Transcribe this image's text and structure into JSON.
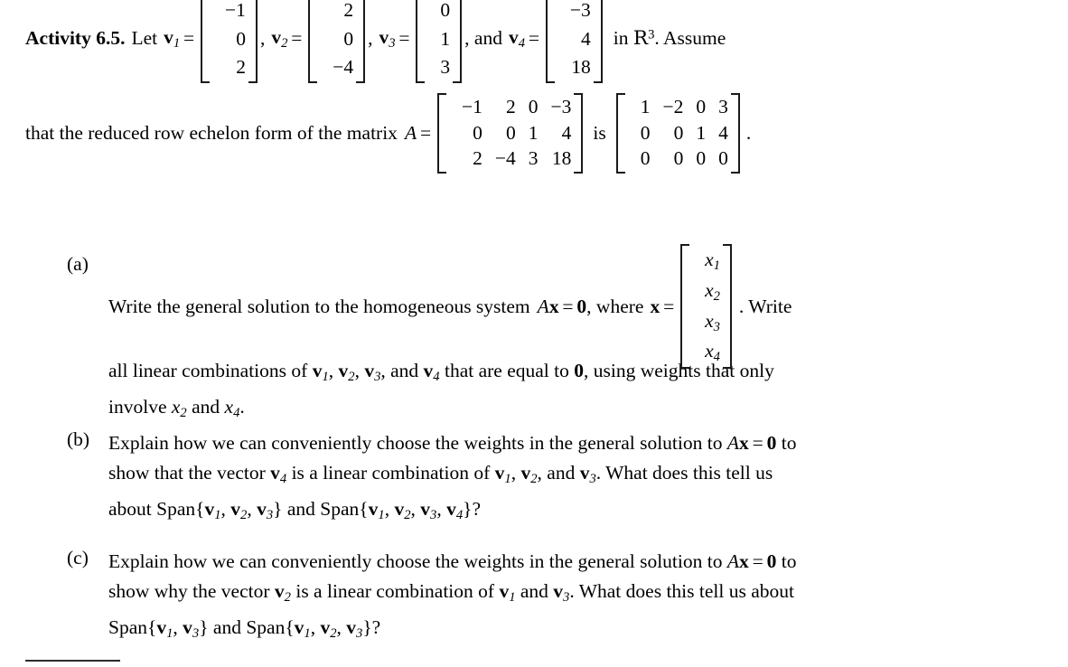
{
  "document": {
    "activity_label": "Activity 6.5.",
    "intro_lead": "Let",
    "vectors": [
      {
        "name": "v",
        "index": "1",
        "entries": [
          "−1",
          "0",
          "2"
        ]
      },
      {
        "name": "v",
        "index": "2",
        "entries": [
          "2",
          "0",
          "−4"
        ]
      },
      {
        "name": "v",
        "index": "3",
        "entries": [
          "0",
          "1",
          "3"
        ]
      },
      {
        "name": "v",
        "index": "4",
        "entries": [
          "−3",
          "4",
          "18"
        ]
      }
    ],
    "separators": {
      "comma": ",",
      "equals": "=",
      "and_before_last": ", and",
      "period": ".",
      "question": "?"
    },
    "space_text": "in",
    "space_symbol": "R",
    "space_exponent": "3",
    "space_trailing": ". Assume",
    "assume_lead": "that the reduced row echelon form of the matrix",
    "matrix_A_name": "A",
    "matrix_A": [
      [
        "−1",
        "2",
        "0",
        "−3"
      ],
      [
        "0",
        "0",
        "1",
        "4"
      ],
      [
        "2",
        "−4",
        "3",
        "18"
      ]
    ],
    "is_word": "is",
    "matrix_rref": [
      [
        "1",
        "−2",
        "0",
        "3"
      ],
      [
        "0",
        "0",
        "1",
        "4"
      ],
      [
        "0",
        "0",
        "0",
        "0"
      ]
    ],
    "matrix_rref_trailing": "."
  },
  "items": [
    {
      "label": "(a)",
      "line1_pre": "Write the general solution to the homogeneous system",
      "equation_matrix": "A",
      "equation_x": "x",
      "equation_eq": "=",
      "equation_zero": "0",
      "line1_mid": ", where",
      "x_vector_name": "x",
      "x_vector_entries": [
        "x",
        "x",
        "x",
        "x"
      ],
      "x_vector_subs": [
        "1",
        "2",
        "3",
        "4"
      ],
      "line1_post": ". Write",
      "line2": "all linear combinations of v₁, v₂, v₃, and v₄ that are equal to 0, using weights that only",
      "line3": "involve x₂ and x₄."
    },
    {
      "label": "(b)",
      "line1": "Explain how we can conveniently choose the weights in the general solution to Ax = 0 to",
      "line2": "show that the vector v₄ is a linear combination of v₁, v₂, and v₃. What does this tell us",
      "line3": "about Span{v₁, v₂, v₃} and Span{v₁, v₂, v₃, v₄}?"
    },
    {
      "label": "(c)",
      "line1": "Explain how we can conveniently choose the weights in the general solution to Ax = 0 to",
      "line2": "show why the vector v₂ is a linear combination of v₁ and v₃. What does this tell us about",
      "line3": "Span{v₁, v₃} and Span{v₁, v₂, v₃}?"
    }
  ],
  "words": {
    "all_linear_combinations_of": "all linear combinations of",
    "that_are_equal_to": "that are equal to",
    "zero_bold": "0",
    "using_weights_that_only": ", using weights that only",
    "involve": "involve",
    "and_word": "and",
    "explain_lead": "Explain how we can conveniently choose the weights in the general solution to",
    "to_word": "to",
    "show_that": "show that the vector",
    "show_why": "show why the vector",
    "is_a_lin_comb_of": "is a linear combination of",
    "what_does_this_tell_us": ". What does this tell us",
    "what_does_this_tell_us_about": ". What does this tell us about",
    "about_word": "about",
    "span_word": "Span",
    "brace_open": "{",
    "brace_close": "}",
    "comma_sp": ", ",
    "period": "."
  },
  "footnote_rule": {
    "visible": true,
    "color": "#2b2b2b"
  }
}
